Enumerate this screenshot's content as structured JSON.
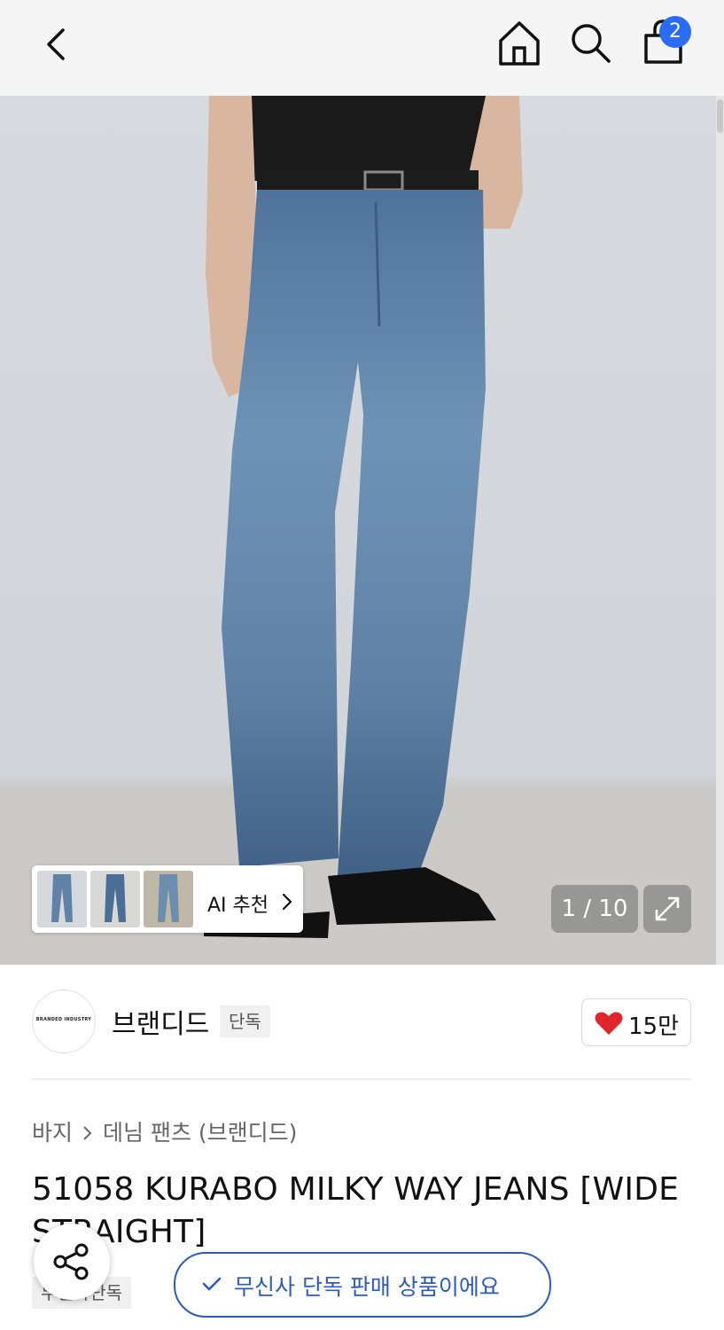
{
  "header": {
    "back_icon": "chevron-left-icon",
    "home_icon": "home-icon",
    "search_icon": "search-icon",
    "bag_icon": "shopping-bag-icon",
    "bag_count": "2",
    "badge_color": "#2a6cf5"
  },
  "gallery": {
    "counter": "1 / 10",
    "ai_label": "AI 추천",
    "expand_icon": "expand-icon"
  },
  "brand": {
    "logo_text": "BRANDED INDUSTRY",
    "name": "브랜디드",
    "tag": "단독",
    "like_count": "15만",
    "heart_color": "#e0262b"
  },
  "breadcrumb": {
    "category": "바지",
    "subcategory": "데님 팬츠 (브랜디드)"
  },
  "product": {
    "title": "51058 KURABO MILKY WAY JEANS [WIDE STRAIGHT]",
    "exclusive_tag": "무신사단독"
  },
  "floating": {
    "share_icon": "share-icon",
    "pill_text": "무신사 단독 판매 상품이에요",
    "accent": "#2d5bb8"
  }
}
